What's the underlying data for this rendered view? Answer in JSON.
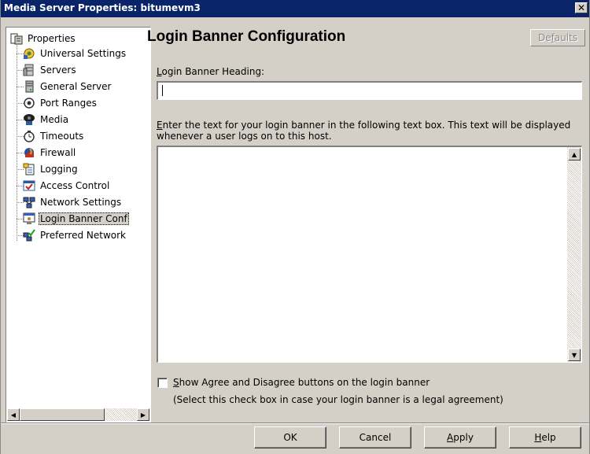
{
  "window": {
    "title": "Media Server Properties: bitumevm3",
    "close_glyph": "✕"
  },
  "tree": {
    "root": {
      "label": "Properties",
      "icon": "properties-icon"
    },
    "items": [
      {
        "label": "Universal Settings",
        "icon": "universal-settings-icon"
      },
      {
        "label": "Servers",
        "icon": "servers-icon"
      },
      {
        "label": "General Server",
        "icon": "general-server-icon"
      },
      {
        "label": "Port Ranges",
        "icon": "port-ranges-icon"
      },
      {
        "label": "Media",
        "icon": "media-icon"
      },
      {
        "label": "Timeouts",
        "icon": "timeouts-icon"
      },
      {
        "label": "Firewall",
        "icon": "firewall-icon"
      },
      {
        "label": "Logging",
        "icon": "logging-icon"
      },
      {
        "label": "Access Control",
        "icon": "access-control-icon"
      },
      {
        "label": "Network Settings",
        "icon": "network-settings-icon"
      },
      {
        "label": "Login Banner Conf",
        "icon": "login-banner-icon",
        "selected": true
      },
      {
        "label": "Preferred Network",
        "icon": "preferred-network-icon"
      }
    ]
  },
  "main": {
    "title": "Login Banner Configuration",
    "defaults_button": {
      "pre": "De",
      "u": "f",
      "post": "aults",
      "enabled": false
    },
    "heading_label": {
      "u": "L",
      "rest": "ogin Banner Heading:"
    },
    "heading_value": "",
    "text_instructions": {
      "u": "E",
      "rest": "nter the text for your login banner in the following text box. This text will be displayed whenever a user logs on to this host."
    },
    "banner_text_value": "",
    "agree_checkbox": {
      "checked": false,
      "u": "S",
      "rest": "how Agree and Disagree buttons on the login banner",
      "note": "(Select this check box in case your login banner is a legal agreement)"
    }
  },
  "footer": {
    "ok": {
      "label": "OK"
    },
    "cancel": {
      "label": "Cancel"
    },
    "apply": {
      "u": "A",
      "rest": "pply"
    },
    "help": {
      "u": "H",
      "rest": "elp"
    }
  }
}
